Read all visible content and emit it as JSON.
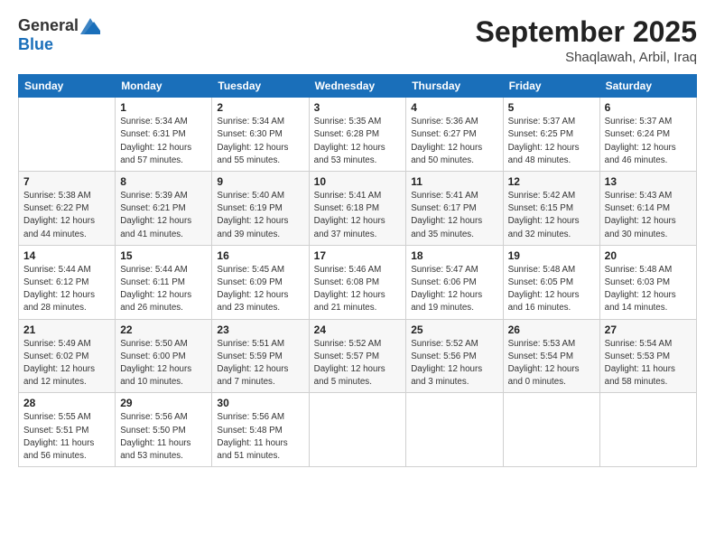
{
  "header": {
    "logo_general": "General",
    "logo_blue": "Blue",
    "month_title": "September 2025",
    "location": "Shaqlawah, Arbil, Iraq"
  },
  "days_of_week": [
    "Sunday",
    "Monday",
    "Tuesday",
    "Wednesday",
    "Thursday",
    "Friday",
    "Saturday"
  ],
  "weeks": [
    [
      {
        "day": "",
        "info": ""
      },
      {
        "day": "1",
        "info": "Sunrise: 5:34 AM\nSunset: 6:31 PM\nDaylight: 12 hours\nand 57 minutes."
      },
      {
        "day": "2",
        "info": "Sunrise: 5:34 AM\nSunset: 6:30 PM\nDaylight: 12 hours\nand 55 minutes."
      },
      {
        "day": "3",
        "info": "Sunrise: 5:35 AM\nSunset: 6:28 PM\nDaylight: 12 hours\nand 53 minutes."
      },
      {
        "day": "4",
        "info": "Sunrise: 5:36 AM\nSunset: 6:27 PM\nDaylight: 12 hours\nand 50 minutes."
      },
      {
        "day": "5",
        "info": "Sunrise: 5:37 AM\nSunset: 6:25 PM\nDaylight: 12 hours\nand 48 minutes."
      },
      {
        "day": "6",
        "info": "Sunrise: 5:37 AM\nSunset: 6:24 PM\nDaylight: 12 hours\nand 46 minutes."
      }
    ],
    [
      {
        "day": "7",
        "info": "Sunrise: 5:38 AM\nSunset: 6:22 PM\nDaylight: 12 hours\nand 44 minutes."
      },
      {
        "day": "8",
        "info": "Sunrise: 5:39 AM\nSunset: 6:21 PM\nDaylight: 12 hours\nand 41 minutes."
      },
      {
        "day": "9",
        "info": "Sunrise: 5:40 AM\nSunset: 6:19 PM\nDaylight: 12 hours\nand 39 minutes."
      },
      {
        "day": "10",
        "info": "Sunrise: 5:41 AM\nSunset: 6:18 PM\nDaylight: 12 hours\nand 37 minutes."
      },
      {
        "day": "11",
        "info": "Sunrise: 5:41 AM\nSunset: 6:17 PM\nDaylight: 12 hours\nand 35 minutes."
      },
      {
        "day": "12",
        "info": "Sunrise: 5:42 AM\nSunset: 6:15 PM\nDaylight: 12 hours\nand 32 minutes."
      },
      {
        "day": "13",
        "info": "Sunrise: 5:43 AM\nSunset: 6:14 PM\nDaylight: 12 hours\nand 30 minutes."
      }
    ],
    [
      {
        "day": "14",
        "info": "Sunrise: 5:44 AM\nSunset: 6:12 PM\nDaylight: 12 hours\nand 28 minutes."
      },
      {
        "day": "15",
        "info": "Sunrise: 5:44 AM\nSunset: 6:11 PM\nDaylight: 12 hours\nand 26 minutes."
      },
      {
        "day": "16",
        "info": "Sunrise: 5:45 AM\nSunset: 6:09 PM\nDaylight: 12 hours\nand 23 minutes."
      },
      {
        "day": "17",
        "info": "Sunrise: 5:46 AM\nSunset: 6:08 PM\nDaylight: 12 hours\nand 21 minutes."
      },
      {
        "day": "18",
        "info": "Sunrise: 5:47 AM\nSunset: 6:06 PM\nDaylight: 12 hours\nand 19 minutes."
      },
      {
        "day": "19",
        "info": "Sunrise: 5:48 AM\nSunset: 6:05 PM\nDaylight: 12 hours\nand 16 minutes."
      },
      {
        "day": "20",
        "info": "Sunrise: 5:48 AM\nSunset: 6:03 PM\nDaylight: 12 hours\nand 14 minutes."
      }
    ],
    [
      {
        "day": "21",
        "info": "Sunrise: 5:49 AM\nSunset: 6:02 PM\nDaylight: 12 hours\nand 12 minutes."
      },
      {
        "day": "22",
        "info": "Sunrise: 5:50 AM\nSunset: 6:00 PM\nDaylight: 12 hours\nand 10 minutes."
      },
      {
        "day": "23",
        "info": "Sunrise: 5:51 AM\nSunset: 5:59 PM\nDaylight: 12 hours\nand 7 minutes."
      },
      {
        "day": "24",
        "info": "Sunrise: 5:52 AM\nSunset: 5:57 PM\nDaylight: 12 hours\nand 5 minutes."
      },
      {
        "day": "25",
        "info": "Sunrise: 5:52 AM\nSunset: 5:56 PM\nDaylight: 12 hours\nand 3 minutes."
      },
      {
        "day": "26",
        "info": "Sunrise: 5:53 AM\nSunset: 5:54 PM\nDaylight: 12 hours\nand 0 minutes."
      },
      {
        "day": "27",
        "info": "Sunrise: 5:54 AM\nSunset: 5:53 PM\nDaylight: 11 hours\nand 58 minutes."
      }
    ],
    [
      {
        "day": "28",
        "info": "Sunrise: 5:55 AM\nSunset: 5:51 PM\nDaylight: 11 hours\nand 56 minutes."
      },
      {
        "day": "29",
        "info": "Sunrise: 5:56 AM\nSunset: 5:50 PM\nDaylight: 11 hours\nand 53 minutes."
      },
      {
        "day": "30",
        "info": "Sunrise: 5:56 AM\nSunset: 5:48 PM\nDaylight: 11 hours\nand 51 minutes."
      },
      {
        "day": "",
        "info": ""
      },
      {
        "day": "",
        "info": ""
      },
      {
        "day": "",
        "info": ""
      },
      {
        "day": "",
        "info": ""
      }
    ]
  ]
}
